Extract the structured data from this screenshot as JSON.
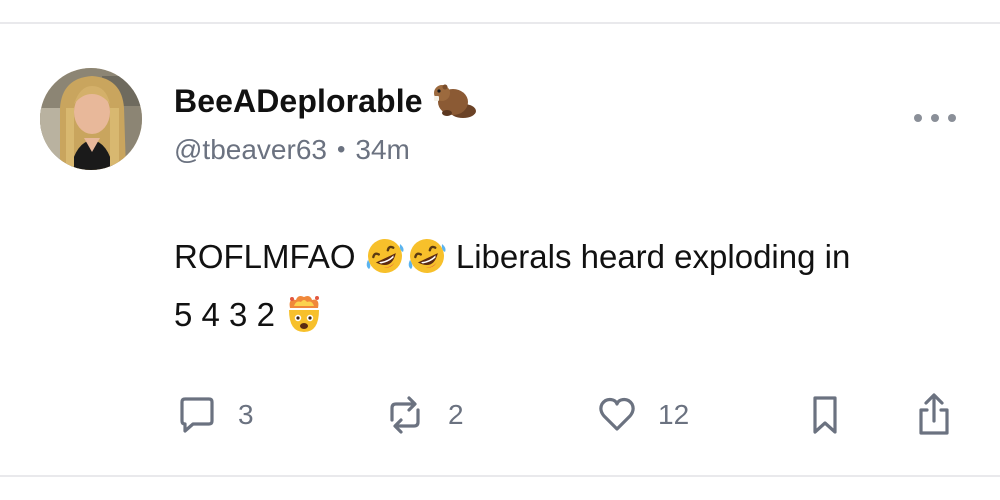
{
  "post": {
    "display_name": "BeeADeplorable",
    "name_emoji": "beaver-emoji",
    "handle": "@tbeaver63",
    "separator": "•",
    "time": "34m",
    "text_part1": "ROFLMFAO",
    "text_part2": "Liberals heard exploding in",
    "text_part3": "5 4 3 2",
    "emojis": [
      "rolling-on-floor-laughing-emoji",
      "rolling-on-floor-laughing-emoji",
      "exploding-head-emoji"
    ]
  },
  "actions": {
    "reply_count": "3",
    "repost_count": "2",
    "like_count": "12"
  },
  "colors": {
    "muted_text": "#6b7280",
    "primary_text": "#111111",
    "divider": "#e9e9ec"
  }
}
